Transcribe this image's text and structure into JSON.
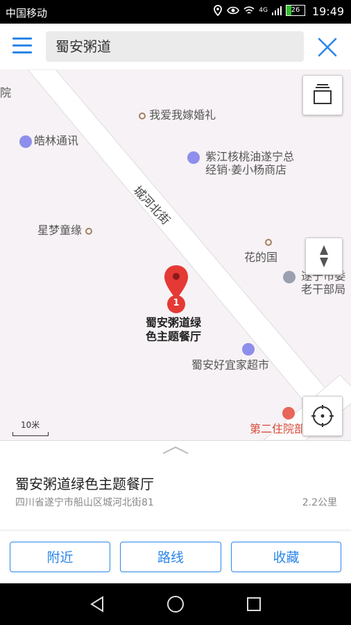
{
  "status_bar": {
    "carrier": "中国移动",
    "network": "4G",
    "battery": "26",
    "battery_level": 0.26,
    "time": "19:49"
  },
  "topbar": {
    "search_value": "蜀安粥道"
  },
  "map": {
    "road_label": "城河北街",
    "pois": {
      "edge_left": "院",
      "wedding": "我爱我嫁婚礼",
      "haolin": "皓林通讯",
      "zijiang_line1": "紫江核桃油遂宁总",
      "zijiang_line2": "经销·姜小杨商店",
      "xingmeng": "星梦童缘",
      "huadeguo": "花的国",
      "suining_line1": "遂宁市委",
      "suining_line2": "老干部局",
      "selected_line1": "蜀安粥道绿",
      "selected_line2": "色主题餐厅",
      "supermarket": "蜀安好宜家超市",
      "hospital": "第二住院部"
    },
    "marker_number": "1",
    "scale_label": "10米"
  },
  "place": {
    "name": "蜀安粥道绿色主题餐厅",
    "address": "四川省遂宁市船山区城河北街81",
    "distance": "2.2公里"
  },
  "actions": {
    "nearby": "附近",
    "route": "路线",
    "favorite": "收藏"
  },
  "colors": {
    "accent": "#2a86e8",
    "marker": "#e53935",
    "map_bg": "#f7f2f5"
  },
  "icons": [
    "menu-icon",
    "close-icon",
    "layers-icon",
    "compass-icon",
    "locate-icon",
    "map-marker-icon",
    "back-icon",
    "home-icon",
    "recents-icon"
  ]
}
